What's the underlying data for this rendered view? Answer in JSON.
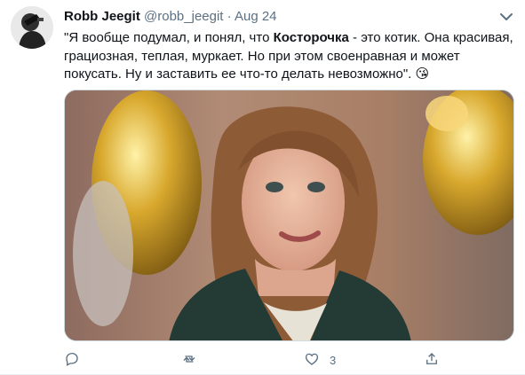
{
  "tweet": {
    "author_name": "Robb Jeegit",
    "handle": "@robb_jeegit",
    "separator": "·",
    "date": "Aug 24",
    "text_before": "\"Я вообще подумал, и понял, что ",
    "text_bold": "Косторочка",
    "text_after": " - это котик. Она красивая, грациозная, теплая, муркает. Но при этом своенравная и может покусать. Ну и заставить ее что-то делать невозможно\". 😘",
    "like_count": "3"
  },
  "icons": {
    "more": "more-caret-icon",
    "reply": "reply-icon",
    "retweet": "retweet-icon",
    "like": "like-icon",
    "share": "share-icon"
  },
  "colors": {
    "text": "#0f1419",
    "secondary": "#5b7083",
    "border": "#cfd9de"
  }
}
